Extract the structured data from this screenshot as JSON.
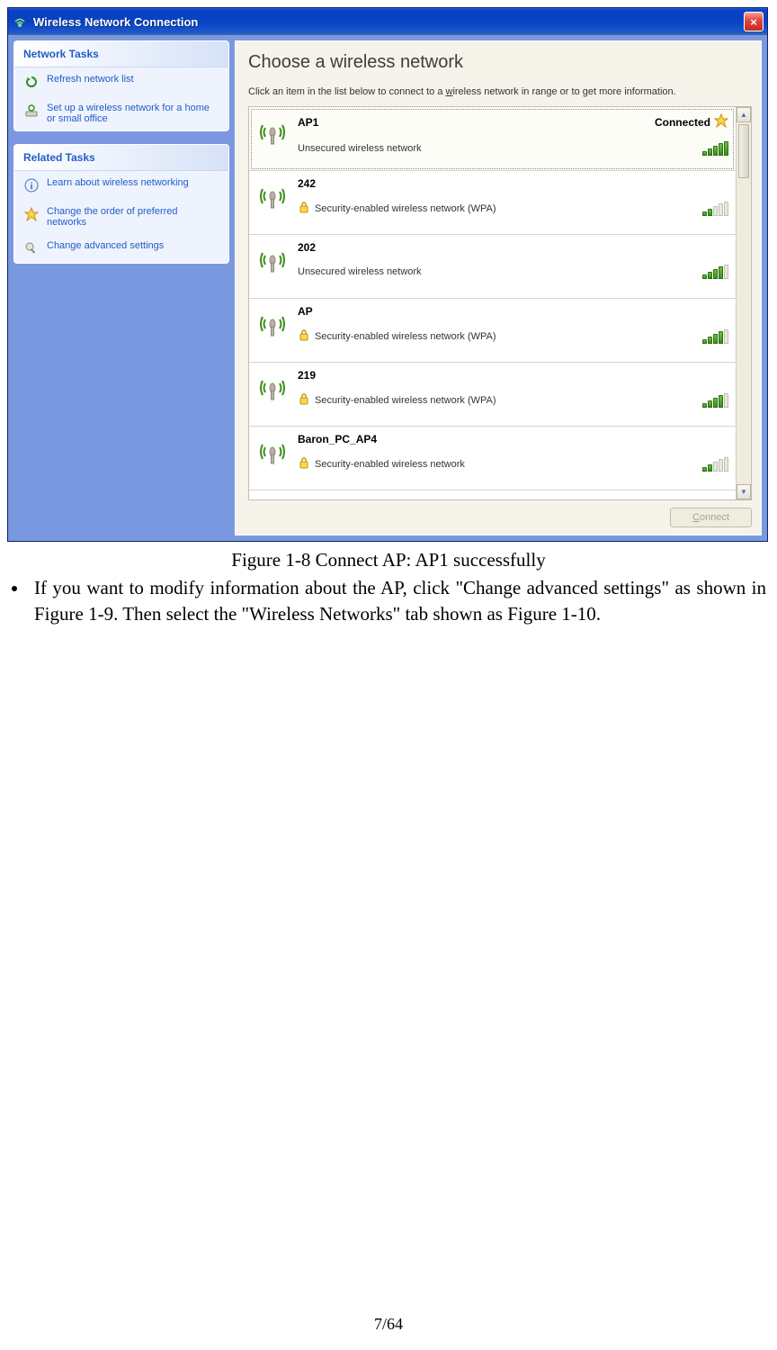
{
  "window": {
    "title": "Wireless Network Connection",
    "close_label": "×"
  },
  "sidebar": {
    "network_tasks": {
      "header": "Network Tasks",
      "items": [
        {
          "label": "Refresh network list",
          "icon": "refresh-icon"
        },
        {
          "label": "Set up a wireless network for a home or small office",
          "icon": "setup-network-icon"
        }
      ]
    },
    "related_tasks": {
      "header": "Related Tasks",
      "items": [
        {
          "label": "Learn about wireless networking",
          "icon": "info-icon"
        },
        {
          "label": "Change the order of preferred networks",
          "icon": "star-icon"
        },
        {
          "label": "Change advanced settings",
          "icon": "settings-icon"
        }
      ]
    }
  },
  "main": {
    "heading": "Choose a wireless network",
    "instruction_prefix": "Click an item in the list below to connect to a ",
    "instruction_underlined": "w",
    "instruction_suffix": "ireless network in range or to get more information.",
    "connect_button": "Connect",
    "networks": [
      {
        "name": "AP1",
        "security": "Unsecured wireless network",
        "signal": 5,
        "locked": false,
        "status": "Connected",
        "favorite": true,
        "selected": true
      },
      {
        "name": "242",
        "security": "Security-enabled wireless network (WPA)",
        "signal": 2,
        "locked": true,
        "status": "",
        "favorite": false,
        "selected": false
      },
      {
        "name": "202",
        "security": "Unsecured wireless network",
        "signal": 4,
        "locked": false,
        "status": "",
        "favorite": false,
        "selected": false
      },
      {
        "name": "AP",
        "security": "Security-enabled wireless network (WPA)",
        "signal": 4,
        "locked": true,
        "status": "",
        "favorite": false,
        "selected": false
      },
      {
        "name": "219",
        "security": "Security-enabled wireless network (WPA)",
        "signal": 4,
        "locked": true,
        "status": "",
        "favorite": false,
        "selected": false
      },
      {
        "name": "Baron_PC_AP4",
        "security": "Security-enabled wireless network",
        "signal": 2,
        "locked": true,
        "status": "",
        "favorite": false,
        "selected": false
      }
    ]
  },
  "doc": {
    "caption": "Figure 1-8 Connect AP: AP1 successfully",
    "bullet": "If you want to modify information about the AP, click \"Change advanced settings\" as shown in Figure 1-9. Then select the \"Wireless Networks\" tab shown as Figure 1-10.",
    "page": "7/64"
  }
}
